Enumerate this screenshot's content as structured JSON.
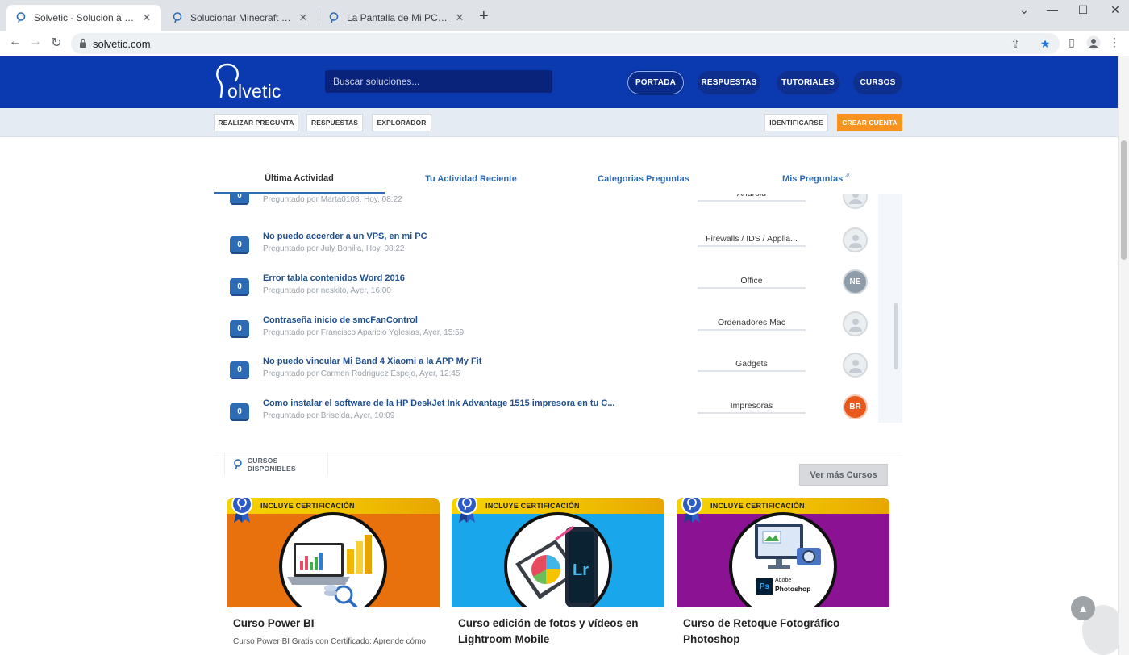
{
  "browser": {
    "tabs": [
      {
        "title": "Solvetic - Solución a los problem",
        "active": true
      },
      {
        "title": "Solucionar Minecraft Launcher no",
        "active": false
      },
      {
        "title": "La Pantalla de Mi PC no se ve Cor",
        "active": false
      }
    ],
    "url": "solvetic.com"
  },
  "site": {
    "logo_text": "olvetic",
    "search_placeholder": "Buscar soluciones...",
    "nav": [
      "PORTADA",
      "RESPUESTAS",
      "TUTORIALES",
      "CURSOS"
    ],
    "subbar": {
      "left": [
        "REALIZAR PREGUNTA",
        "RESPUESTAS",
        "EXPLORADOR"
      ],
      "login": "IDENTIFICARSE",
      "signup": "CREAR CUENTA"
    }
  },
  "activity_tabs": [
    "Última Actividad",
    "Tu Actividad Reciente",
    "Categorias Preguntas",
    "Mis Preguntas"
  ],
  "questions": [
    {
      "count": "0",
      "title": "",
      "meta": "Preguntado por Marta0108, Hoy, 08:22",
      "category": "Android",
      "avatar": ""
    },
    {
      "count": "0",
      "title": "No puedo accerder a un VPS, en mi PC",
      "meta": "Preguntado por July Bonilla, Hoy, 08:22",
      "category": "Firewalls / IDS / Applia...",
      "avatar": ""
    },
    {
      "count": "0",
      "title": "Error tabla contenidos Word 2016",
      "meta": "Preguntado por neskito, Ayer, 16:00",
      "category": "Office",
      "avatar": "NE"
    },
    {
      "count": "0",
      "title": "Contraseña inicio de smcFanControl",
      "meta": "Preguntado por Francisco Aparicio Yglesias, Ayer, 15:59",
      "category": "Ordenadores Mac",
      "avatar": ""
    },
    {
      "count": "0",
      "title": "No puedo vincular Mi Band 4 Xiaomi a la APP My Fit",
      "meta": "Preguntado por Carmen Rodriguez Espejo, Ayer, 12:45",
      "category": "Gadgets",
      "avatar": ""
    },
    {
      "count": "0",
      "title": "Como instalar el software de la HP DeskJet Ink Advantage 1515 impresora en tu C...",
      "meta": "Preguntado por Briseida, Ayer, 10:09",
      "category": "Impresoras",
      "avatar": "BR"
    }
  ],
  "courses_section": {
    "label": "CURSOS DISPONIBLES",
    "more_button": "Ver más Cursos",
    "ribbon": "INCLUYE CERTIFICACIÓN",
    "cards": [
      {
        "title": "Curso Power BI",
        "desc": "Curso Power BI Gratis con Certificado: Aprende cómo",
        "color": "#e8700d"
      },
      {
        "title": "Curso edición de fotos y vídeos en Lightroom Mobile",
        "desc": "",
        "color": "#1aa6ea"
      },
      {
        "title": "Curso de Retoque Fotográfico Photoshop",
        "desc": "",
        "color": "#8a1293",
        "badge_line1": "Adobe",
        "badge_line2": "Photoshop"
      }
    ]
  },
  "colors": {
    "header": "#0b3ab0",
    "accent": "#2d6bb5",
    "orange": "#f7931e"
  }
}
